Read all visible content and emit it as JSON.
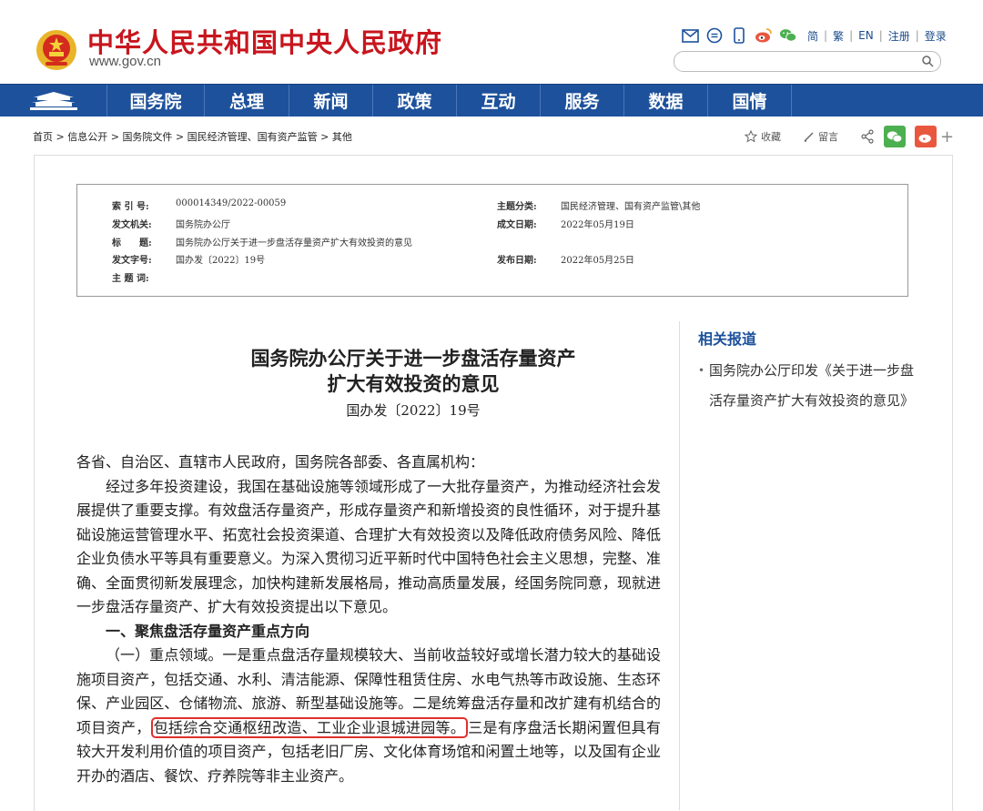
{
  "header": {
    "site_title": "中华人民共和国中央人民政府",
    "site_url": "www.gov.cn",
    "lang_links": [
      "简",
      "繁",
      "EN",
      "注册",
      "登录"
    ],
    "search_placeholder": ""
  },
  "nav": {
    "items": [
      "国务院",
      "总理",
      "新闻",
      "政策",
      "互动",
      "服务",
      "数据",
      "国情"
    ]
  },
  "breadcrumb": {
    "items": [
      "首页",
      "信息公开",
      "国务院文件",
      "国民经济管理、国有资产监管",
      "其他"
    ],
    "separator": " > "
  },
  "share": {
    "favorite_label": "收藏",
    "comment_label": "留言",
    "plus": "+"
  },
  "info": {
    "index_label": "索 引 号:",
    "index_value": "000014349/2022-00059",
    "topic_label": "主题分类:",
    "topic_value": "国民经济管理、国有资产监管\\其他",
    "issuer_label": "发文机关:",
    "issuer_value": "国务院办公厅",
    "created_label": "成文日期:",
    "created_value": "2022年05月19日",
    "title_label": "标　　题:",
    "title_value": "国务院办公厅关于进一步盘活存量资产扩大有效投资的意见",
    "doc_no_label": "发文字号:",
    "doc_no_value": "国办发〔2022〕19号",
    "published_label": "发布日期:",
    "published_value": "2022年05月25日",
    "keywords_label": "主 题 词:",
    "keywords_value": ""
  },
  "document": {
    "title_line1": "国务院办公厅关于进一步盘活存量资产",
    "title_line2": "扩大有效投资的意见",
    "doc_number": "国办发〔2022〕19号",
    "salutation": "各省、自治区、直辖市人民政府，国务院各部委、各直属机构：",
    "para1": "经过多年投资建设，我国在基础设施等领域形成了一大批存量资产，为推动经济社会发展提供了重要支撑。有效盘活存量资产，形成存量资产和新增投资的良性循环，对于提升基础设施运营管理水平、拓宽社会投资渠道、合理扩大有效投资以及降低政府债务风险、降低企业负债水平等具有重要意义。为深入贯彻习近平新时代中国特色社会主义思想，完整、准确、全面贯彻新发展理念，加快构建新发展格局，推动高质量发展，经国务院同意，现就进一步盘活存量资产、扩大有效投资提出以下意见。",
    "section1": "一、聚焦盘活存量资产重点方向",
    "para2_before": "（一）重点领域。一是重点盘活存量规模较大、当前收益较好或增长潜力较大的基础设施项目资产，包括交通、水利、清洁能源、保障性租赁住房、水电气热等市政设施、生态环保、产业园区、仓储物流、旅游、新型基础设施等。二是统筹盘活存量和改扩建有机结合的项目资产，",
    "para2_highlight": "包括综合交通枢纽改造、工业企业退城进园等。",
    "para2_after": "三是有序盘活长期闲置但具有较大开发利用价值的项目资产，包括老旧厂房、文化体育场馆和闲置土地等，以及国有企业开办的酒店、餐饮、疗养院等非主业资产。"
  },
  "sidebar": {
    "title": "相关报道",
    "item1": "国务院办公厅印发《关于进一步盘活存量资产扩大有效投资的意见》"
  },
  "colors": {
    "brand_red": "#c8161e",
    "nav_blue": "#1d519b",
    "highlight_red": "#e0302b",
    "wechat_green": "#4caf50",
    "weibo_orange": "#e9573f"
  }
}
